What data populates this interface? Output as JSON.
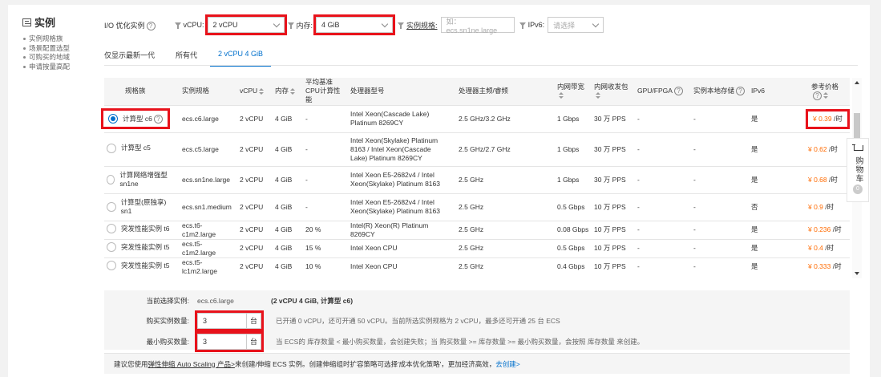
{
  "sidebar": {
    "title": "实例",
    "items": [
      "实例规格族",
      "场景配置选型",
      "可购买的地域",
      "申请按量高配"
    ]
  },
  "filters": {
    "io_opt_label": "I/O 优化实例",
    "vcpu_label": "vCPU:",
    "vcpu_value": "2 vCPU",
    "mem_label": "内存:",
    "mem_value": "4 GiB",
    "spec_label": "实例规格:",
    "spec_placeholder": "如：ecs.sn1ne.large",
    "ipv6_label": "IPv6:",
    "ipv6_placeholder": "请选择"
  },
  "tabs": [
    {
      "label": "仅显示最新一代",
      "active": false
    },
    {
      "label": "所有代",
      "active": false
    },
    {
      "label": "2 vCPU 4 GiB",
      "active": true
    }
  ],
  "table": {
    "headers": {
      "family": "规格族",
      "spec": "实例规格",
      "vcpu": "vCPU",
      "mem": "内存",
      "baseline": "平均基准CPU计算性能",
      "cpu_model": "处理器型号",
      "freq": "处理器主频/睿频",
      "bw": "内网带宽",
      "pps": "内网收发包",
      "gpu": "GPU/FPGA",
      "local": "实例本地存储",
      "ipv6": "IPv6",
      "price": "参考价格"
    },
    "rows": [
      {
        "family": "计算型 c6",
        "spec": "ecs.c6.large",
        "vcpu": "2 vCPU",
        "mem": "4 GiB",
        "baseline": "-",
        "cpu_model": "Intel Xeon(Cascade Lake) Platinum 8269CY",
        "freq": "2.5 GHz/3.2 GHz",
        "bw": "1 Gbps",
        "pps": "30 万 PPS",
        "gpu": "-",
        "local": "-",
        "ipv6": "是",
        "price": "¥ 0.39",
        "per": " /时",
        "selected": true
      },
      {
        "family": "计算型 c5",
        "spec": "ecs.c5.large",
        "vcpu": "2 vCPU",
        "mem": "4 GiB",
        "baseline": "-",
        "cpu_model": "Intel Xeon(Skylake) Platinum 8163 / Intel Xeon(Cascade Lake) Platinum 8269CY",
        "freq": "2.5 GHz/2.7 GHz",
        "bw": "1 Gbps",
        "pps": "30 万 PPS",
        "gpu": "-",
        "local": "-",
        "ipv6": "是",
        "price": "¥ 0.62",
        "per": " /时",
        "selected": false
      },
      {
        "family": "计算网络增强型 sn1ne",
        "spec": "ecs.sn1ne.large",
        "vcpu": "2 vCPU",
        "mem": "4 GiB",
        "baseline": "-",
        "cpu_model": "Intel Xeon E5-2682v4 / Intel Xeon(Skylake) Platinum 8163",
        "freq": "2.5 GHz",
        "bw": "1 Gbps",
        "pps": "30 万 PPS",
        "gpu": "-",
        "local": "-",
        "ipv6": "是",
        "price": "¥ 0.68",
        "per": " /时",
        "selected": false
      },
      {
        "family": "计算型(原独享) sn1",
        "spec": "ecs.sn1.medium",
        "vcpu": "2 vCPU",
        "mem": "4 GiB",
        "baseline": "-",
        "cpu_model": "Intel Xeon E5-2682v4 / Intel Xeon(Skylake) Platinum 8163",
        "freq": "2.5 GHz",
        "bw": "0.5 Gbps",
        "pps": "10 万 PPS",
        "gpu": "-",
        "local": "-",
        "ipv6": "否",
        "price": "¥ 0.9",
        "per": " /时",
        "selected": false
      },
      {
        "family": "突发性能实例 t6",
        "spec": "ecs.t6-c1m2.large",
        "vcpu": "2 vCPU",
        "mem": "4 GiB",
        "baseline": "20 %",
        "cpu_model": "Intel(R) Xeon(R) Platinum 8269CY",
        "freq": "2.5 GHz",
        "bw": "0.08 Gbps",
        "pps": "10 万 PPS",
        "gpu": "-",
        "local": "-",
        "ipv6": "是",
        "price": "¥ 0.236",
        "per": " /时",
        "selected": false
      },
      {
        "family": "突发性能实例 t5",
        "spec": "ecs.t5-c1m2.large",
        "vcpu": "2 vCPU",
        "mem": "4 GiB",
        "baseline": "15 %",
        "cpu_model": "Intel Xeon CPU",
        "freq": "2.5 GHz",
        "bw": "0.5 Gbps",
        "pps": "10 万 PPS",
        "gpu": "-",
        "local": "-",
        "ipv6": "是",
        "price": "¥ 0.4",
        "per": " /时",
        "selected": false
      },
      {
        "family": "突发性能实例 t5",
        "spec": "ecs.t5-lc1m2.large",
        "vcpu": "2 vCPU",
        "mem": "4 GiB",
        "baseline": "10 %",
        "cpu_model": "Intel Xeon CPU",
        "freq": "2.5 GHz",
        "bw": "0.4 Gbps",
        "pps": "10 万 PPS",
        "gpu": "-",
        "local": "-",
        "ipv6": "是",
        "price": "¥ 0.333",
        "per": " /时",
        "selected": false
      }
    ]
  },
  "cart": {
    "label": "购物车",
    "count": "0"
  },
  "summary": {
    "current_label": "当前选择实例:",
    "current_value": "ecs.c6.large",
    "current_desc": "(2 vCPU 4 GiB, 计算型 c6)",
    "buy_label": "购买实例数量:",
    "buy_value": "3",
    "buy_unit": "台",
    "buy_hint": "已开通 0 vCPU，还可开通 50 vCPU。当前所选实例规格为 2 vCPU，最多还可开通 25 台 ECS",
    "min_label": "最小购买数量:",
    "min_value": "3",
    "min_unit": "台",
    "min_hint": "当 ECS的 库存数量 < 最小购买数量，会创建失败；当 购买数量 >= 库存数量 >= 最小购买数量，会按照 库存数量 来创建。"
  },
  "footer": {
    "text_before": "建议您使用 ",
    "as_link": "弹性伸缩 Auto Scaling 产品>",
    "text_after": " 来创建/伸缩 ECS 实例。创建伸缩组时扩容策略可选择'成本优化策略'，更加经济高效，",
    "create_link": "去创建>"
  },
  "colors": {
    "accent": "#0070cc",
    "price": "#ff6a00",
    "highlight": "#e8121b"
  }
}
